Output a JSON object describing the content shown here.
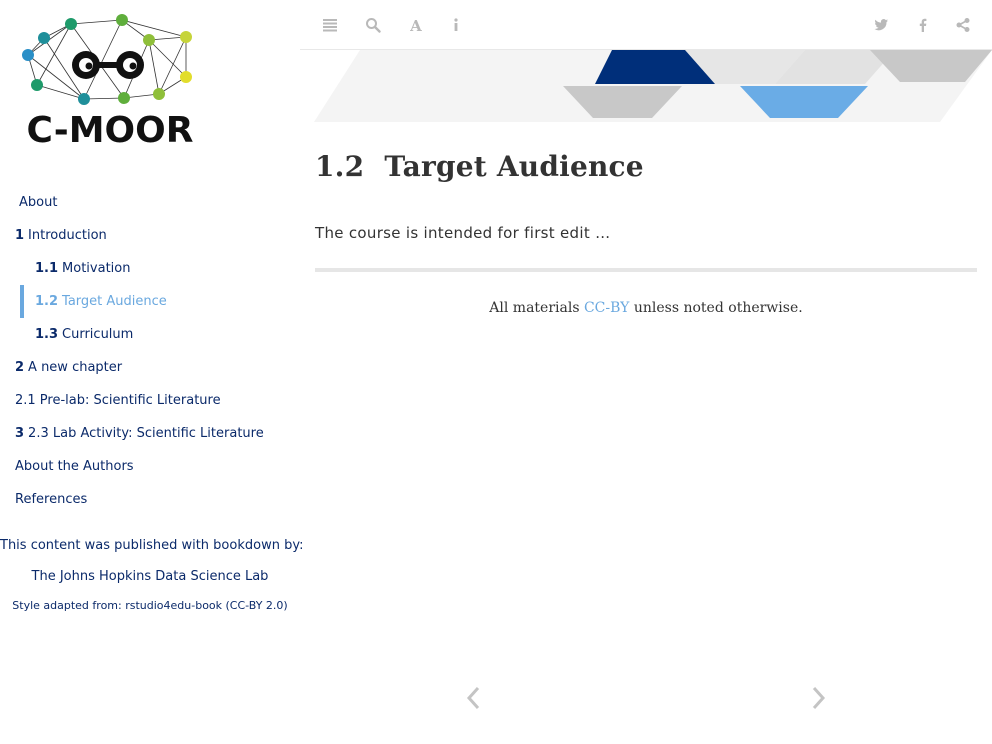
{
  "logo": {
    "text": "C-MOOR"
  },
  "toc": [
    {
      "num": "",
      "label": "About",
      "level": 0,
      "active": false
    },
    {
      "num": "1",
      "label": "Introduction",
      "level": 0,
      "active": false
    },
    {
      "num": "1.1",
      "label": "Motivation",
      "level": 1,
      "active": false
    },
    {
      "num": "1.2",
      "label": "Target Audience",
      "level": 1,
      "active": true
    },
    {
      "num": "1.3",
      "label": "Curriculum",
      "level": 1,
      "active": false
    },
    {
      "num": "2",
      "label": "A new chapter",
      "level": 0,
      "active": false
    },
    {
      "num": "",
      "label": "2.1 Pre-lab: Scientific Literature",
      "level": 0,
      "active": false
    },
    {
      "num": "3",
      "label": "2.3 Lab Activity: Scientific Literature",
      "level": 0,
      "active": false
    },
    {
      "num": "",
      "label": "About the Authors",
      "level": 0,
      "active": false
    },
    {
      "num": "",
      "label": "References",
      "level": 0,
      "active": false
    }
  ],
  "published": {
    "line": "This content was published with bookdown by:",
    "link": "The Johns Hopkins Data Science Lab",
    "style": "Style adapted from: rstudio4edu-book (CC-BY 2.0)"
  },
  "toolbar": {
    "left_icons": [
      "toc-toggle-icon",
      "search-icon",
      "font-settings-icon",
      "info-icon"
    ],
    "right_icons": [
      "twitter-icon",
      "facebook-icon",
      "share-icon"
    ]
  },
  "content": {
    "section_number": "1.2",
    "section_title": "Target Audience",
    "paragraph": "The course is intended for first edit …",
    "license_prefix": "All materials",
    "license_link": "CC-BY",
    "license_suffix": "unless noted otherwise."
  },
  "nav": {
    "prev_icon": "chevron-left-icon",
    "next_icon": "chevron-right-icon"
  },
  "colors": {
    "navy": "#0b2a6a",
    "accent": "#6aa8df",
    "text": "#333333",
    "icon_gray": "#b9b9b9",
    "banner_dark": "#002f7a",
    "banner_light": "#6aace6",
    "banner_gray": "#c8c8c8"
  }
}
